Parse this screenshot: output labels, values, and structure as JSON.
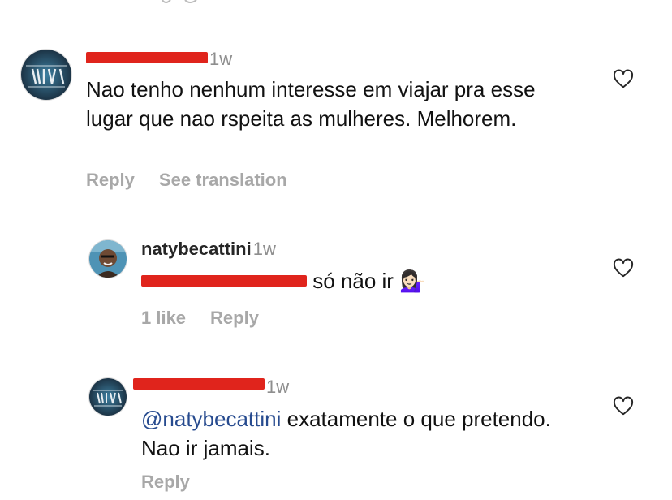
{
  "comments": [
    {
      "username": "",
      "time": "1w",
      "text": "Nao tenho nenhum interesse em viajar pra esse lugar que nao rspeita as mulheres. Melhorem.",
      "actions": {
        "reply": "Reply",
        "translate": "See translation"
      }
    },
    {
      "username": "natybecattini",
      "time": "1w",
      "mention": "",
      "text": "só não ir",
      "emoji": "💁🏻‍♀️",
      "actions": {
        "likes": "1 like",
        "reply": "Reply"
      }
    },
    {
      "username": "",
      "time": "1w",
      "mention": "@natybecattini",
      "text": "exatamente o que pretendo. Nao ir jamais.",
      "actions": {
        "reply": "Reply"
      }
    }
  ],
  "colors": {
    "mention": "#274b8f",
    "redaction": "#e0241c",
    "muted": "#8e8e8e"
  },
  "icons": [
    "avatar-davis",
    "avatar-naty",
    "heart-outline-icon",
    "information-desk-person-emoji"
  ]
}
